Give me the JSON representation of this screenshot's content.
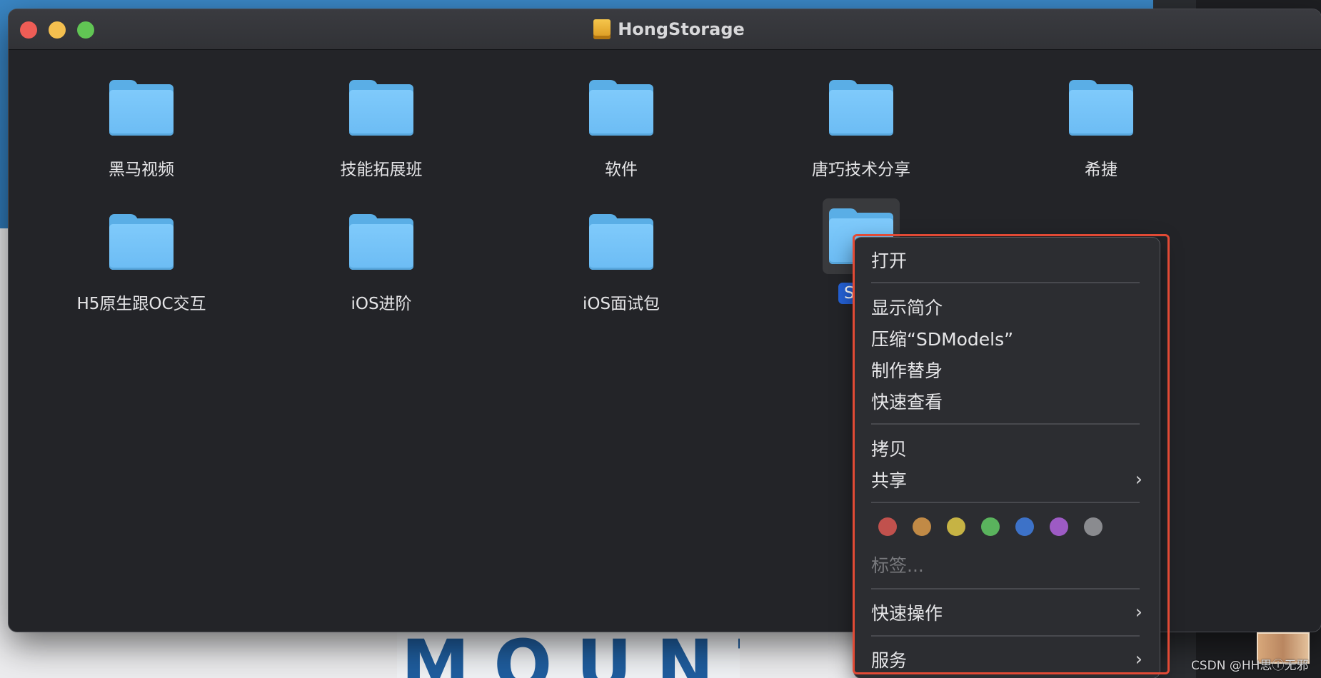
{
  "window": {
    "title": "HongStorage"
  },
  "folders": [
    {
      "name": "黑马视频"
    },
    {
      "name": "技能拓展班"
    },
    {
      "name": "软件"
    },
    {
      "name": "唐巧技术分享"
    },
    {
      "name": "希捷"
    },
    {
      "name": "H5原生跟OC交互"
    },
    {
      "name": "iOS进阶"
    },
    {
      "name": "iOS面试包"
    },
    {
      "name": "SDM"
    }
  ],
  "context_menu": {
    "open": "打开",
    "get_info": "显示简介",
    "compress": "压缩“SDModels”",
    "make_alias": "制作替身",
    "quick_look": "快速查看",
    "copy": "拷贝",
    "share": "共享",
    "tags": "标签...",
    "quick_actions": "快速操作",
    "services": "服务",
    "tag_colors": [
      "#c1514d",
      "#c18a46",
      "#c6b344",
      "#5ab35d",
      "#3d72c8",
      "#9d5bc4",
      "#8a8b8f"
    ]
  },
  "background": {
    "banner_text": "MOUNTY"
  },
  "watermark": "CSDN @HH思ⓘ无邪"
}
